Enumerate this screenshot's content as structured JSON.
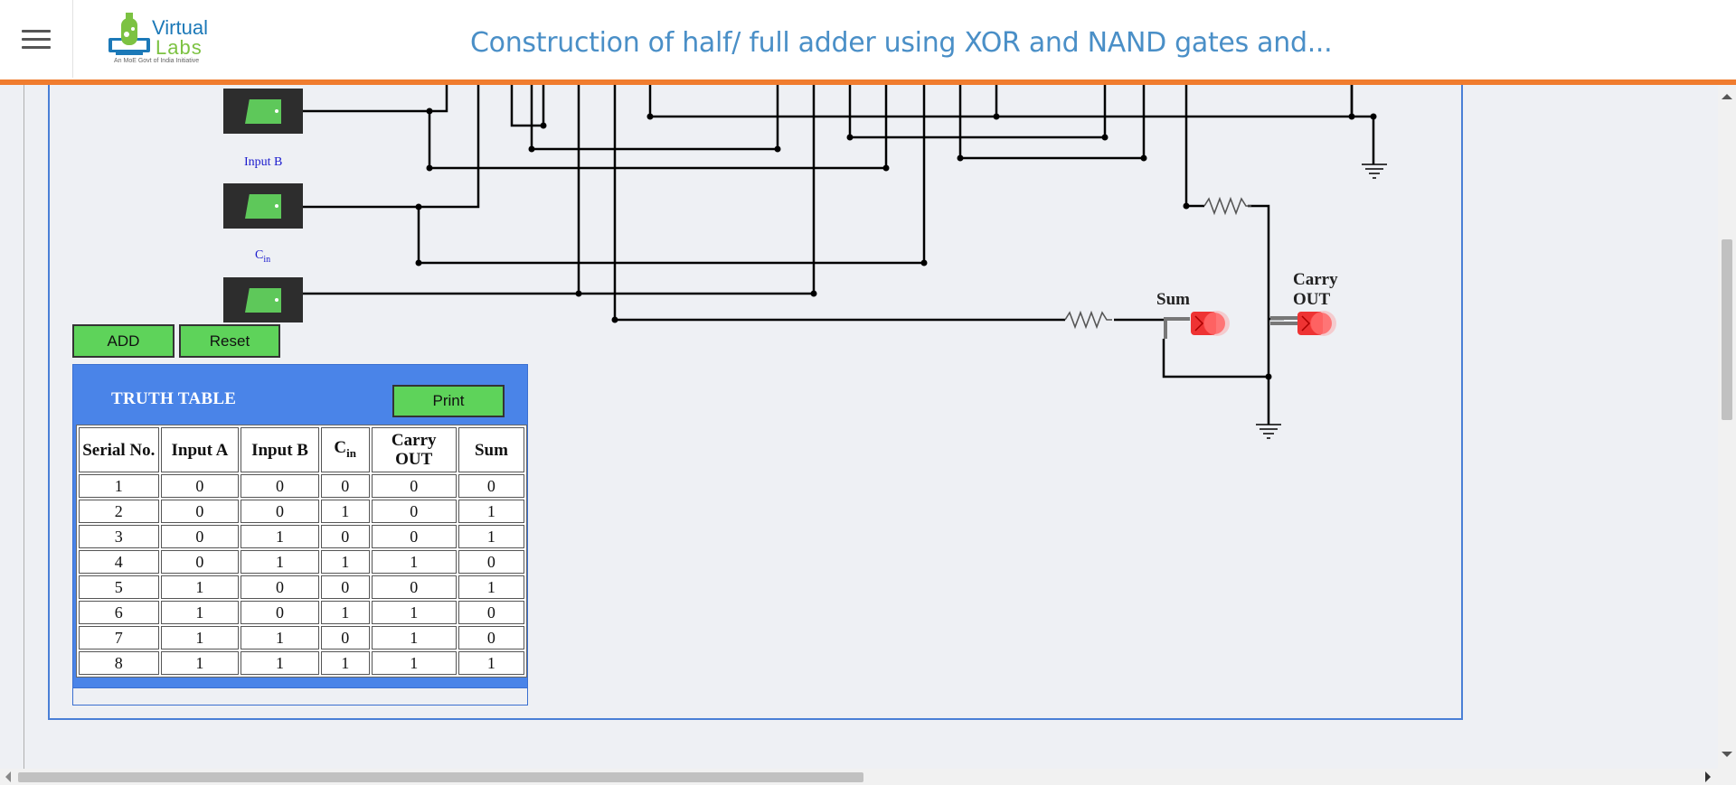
{
  "header": {
    "menu_icon": "hamburger-icon",
    "logo": {
      "word1": "Virtual",
      "word2": "Labs",
      "tagline": "An MoE Govt of India Initiative"
    },
    "title": "Construction of half/ full adder using XOR and NAND gates and..."
  },
  "colors": {
    "accent_orange": "#f07c2e",
    "panel_blue": "#4a84e8",
    "button_green": "#5ed35a",
    "title_blue": "#4a8fc7"
  },
  "circuit": {
    "switches": [
      {
        "label": "Input B"
      },
      {
        "label_main": "C",
        "label_sub": "in"
      }
    ],
    "leds": {
      "sum": "Sum",
      "carry_line1": "Carry",
      "carry_line2": "OUT"
    }
  },
  "controls": {
    "add": "ADD",
    "reset": "Reset"
  },
  "truth_table": {
    "title": "TRUTH TABLE",
    "print": "Print",
    "headers": {
      "serial": "Serial No.",
      "input_a": "Input A",
      "input_b": "Input B",
      "cin_main": "C",
      "cin_sub": "in",
      "carry_line1": "Carry",
      "carry_line2": "OUT",
      "sum": "Sum"
    },
    "rows": [
      [
        "1",
        "0",
        "0",
        "0",
        "0",
        "0"
      ],
      [
        "2",
        "0",
        "0",
        "1",
        "0",
        "1"
      ],
      [
        "3",
        "0",
        "1",
        "0",
        "0",
        "1"
      ],
      [
        "4",
        "0",
        "1",
        "1",
        "1",
        "0"
      ],
      [
        "5",
        "1",
        "0",
        "0",
        "0",
        "1"
      ],
      [
        "6",
        "1",
        "0",
        "1",
        "1",
        "0"
      ],
      [
        "7",
        "1",
        "1",
        "0",
        "1",
        "0"
      ],
      [
        "8",
        "1",
        "1",
        "1",
        "1",
        "1"
      ]
    ]
  }
}
